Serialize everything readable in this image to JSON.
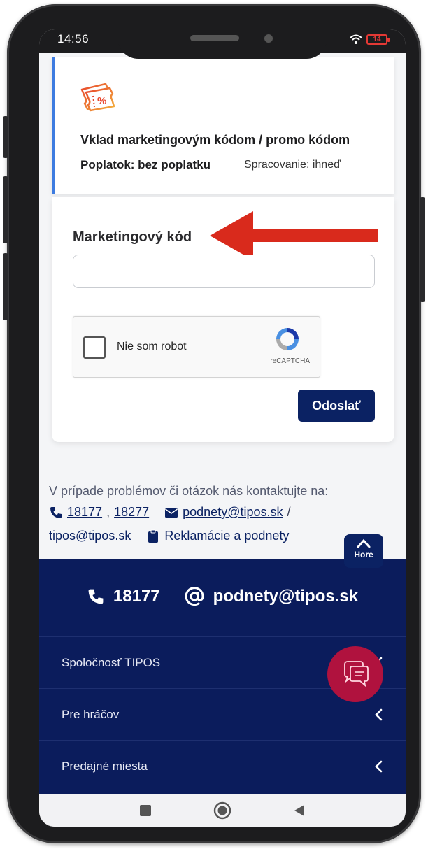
{
  "status_bar": {
    "time": "14:56",
    "battery": "14"
  },
  "payment_method": {
    "title": "Vklad marketingovým kódom / promo kódom",
    "fee": "Poplatok: bez poplatku",
    "processing": "Spracovanie: ihneď",
    "accent_color": "#3d7be0"
  },
  "form": {
    "code_label": "Marketingový kód",
    "code_value": "",
    "captcha_label": "Nie som robot",
    "captcha_brand": "reCAPTCHA",
    "submit_label": "Odoslať"
  },
  "contact": {
    "intro": "V prípade problémov či otázok nás kontaktujte na:",
    "phone_1": "18177",
    "phone_2": "18277",
    "email_1": "podnety@tipos.sk",
    "separator": "/",
    "email_2": "tipos@tipos.sk",
    "complaints_link": "Reklamácie a podnety"
  },
  "back_to_top": {
    "label": "Hore"
  },
  "footer": {
    "phone": "18177",
    "email": "podnety@tipos.sk",
    "menu": [
      {
        "label": "Spoločnosť TIPOS"
      },
      {
        "label": "Pre hráčov"
      },
      {
        "label": "Predajné miesta"
      }
    ],
    "bg_color": "#0b1c5c"
  },
  "colors": {
    "brand_navy": "#0b2263",
    "chat_red": "#b0123e",
    "arrow_red": "#d92a1c"
  },
  "icons": {
    "payment": "promo-ticket-icon",
    "phone": "phone-icon",
    "mail": "mail-icon",
    "clipboard": "clipboard-icon",
    "at": "at-icon",
    "chevron": "chevron-left-icon",
    "chat": "chat-icon"
  }
}
